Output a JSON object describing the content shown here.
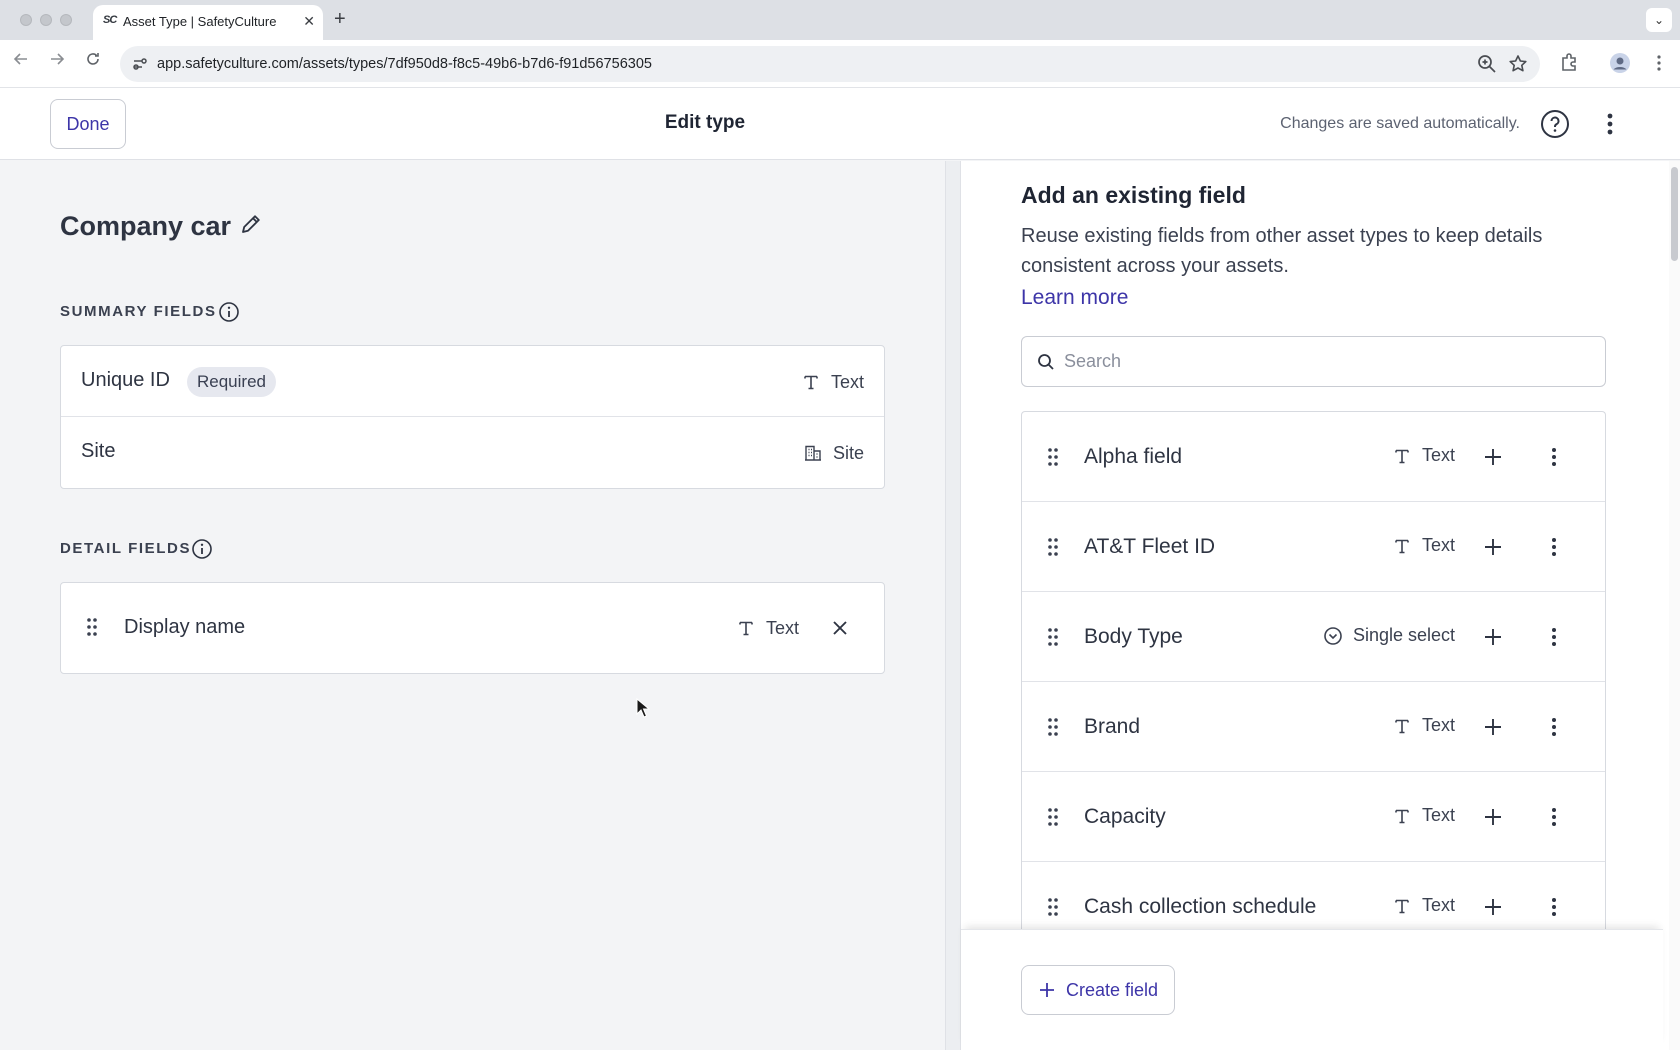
{
  "browser": {
    "tab_title": "Asset Type | SafetyCulture",
    "tab_favicon": "SC",
    "url": "app.safetyculture.com/assets/types/7df950d8-f8c5-49b6-b7d6-f91d56756305",
    "icons": [
      "back-icon",
      "forward-icon",
      "reload-icon",
      "site-info-icon",
      "zoom-icon",
      "bookmark-star-icon",
      "extensions-icon",
      "profile-icon",
      "menu-icon"
    ]
  },
  "header": {
    "done_label": "Done",
    "title": "Edit type",
    "autosave_text": "Changes are saved automatically."
  },
  "asset_type": {
    "name": "Company car"
  },
  "summary_fields": {
    "title": "SUMMARY FIELDS",
    "items": [
      {
        "label": "Unique ID",
        "badge": "Required",
        "type": "Text",
        "type_icon": "text-type-icon"
      },
      {
        "label": "Site",
        "badge": "",
        "type": "Site",
        "type_icon": "building-icon"
      }
    ]
  },
  "detail_fields": {
    "title": "DETAIL FIELDS",
    "items": [
      {
        "label": "Display name",
        "type": "Text",
        "type_icon": "text-type-icon"
      }
    ]
  },
  "existing_fields": {
    "title": "Add an existing field",
    "description": "Reuse existing fields from other asset types to keep details consistent across your assets.",
    "learn_more": "Learn more",
    "search_placeholder": "Search",
    "items": [
      {
        "name": "Alpha field",
        "type": "Text",
        "type_icon": "text-type-icon"
      },
      {
        "name": "AT&T Fleet ID",
        "type": "Text",
        "type_icon": "text-type-icon"
      },
      {
        "name": "Body Type",
        "type": "Single select",
        "type_icon": "single-select-icon"
      },
      {
        "name": "Brand",
        "type": "Text",
        "type_icon": "text-type-icon"
      },
      {
        "name": "Capacity",
        "type": "Text",
        "type_icon": "text-type-icon"
      },
      {
        "name": "Cash collection schedule",
        "type": "Text",
        "type_icon": "text-type-icon"
      }
    ],
    "create_label": "Create field"
  },
  "colors": {
    "accent": "#3d35a8",
    "page_bg": "#f3f4f6",
    "border": "#d7dae0"
  }
}
